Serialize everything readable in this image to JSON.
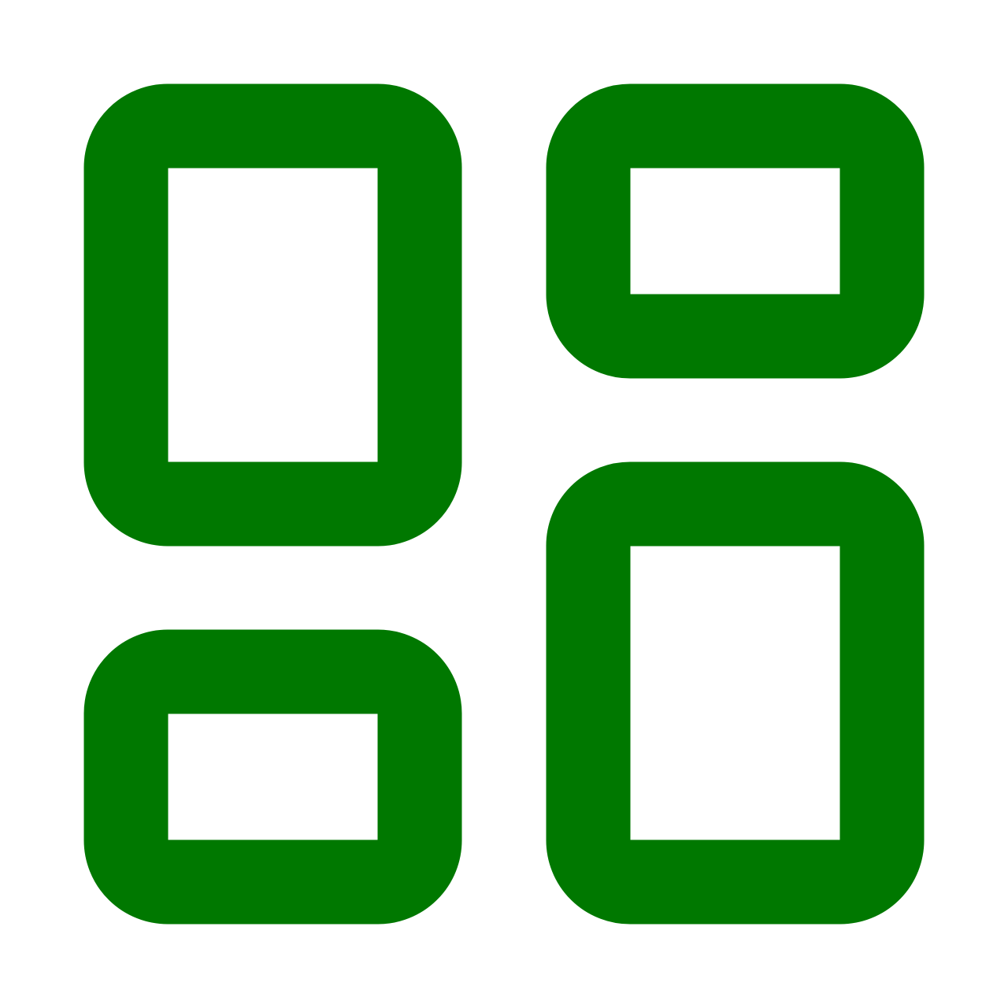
{
  "icon": {
    "name": "dashboard-layout-icon",
    "color": "#007800",
    "background": "#ffffff",
    "panels": [
      {
        "name": "top-left-panel"
      },
      {
        "name": "top-right-panel"
      },
      {
        "name": "bottom-left-panel"
      },
      {
        "name": "bottom-right-panel"
      }
    ]
  }
}
